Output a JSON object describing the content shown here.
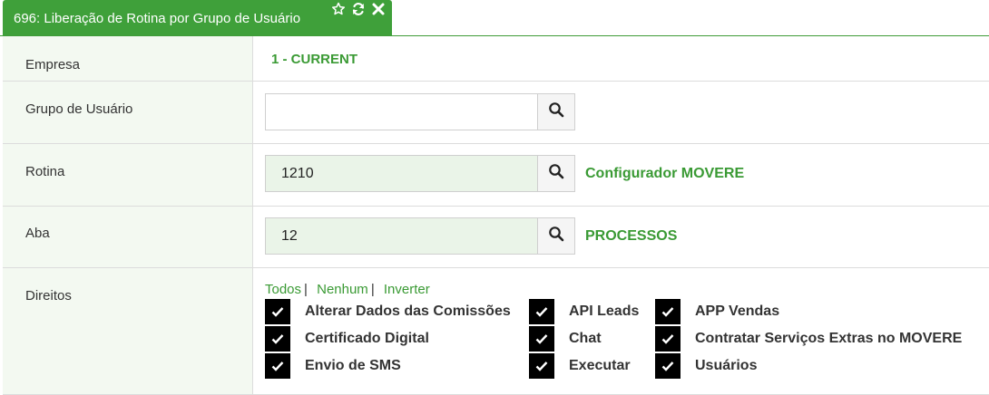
{
  "tab": {
    "title": "696: Liberação de Rotina por Grupo de Usuário"
  },
  "form": {
    "empresa": {
      "label": "Empresa",
      "value": "1 - CURRENT"
    },
    "grupo": {
      "label": "Grupo de Usuário",
      "value": ""
    },
    "rotina": {
      "label": "Rotina",
      "value": "1210",
      "description": "Configurador MOVERE"
    },
    "aba": {
      "label": "Aba",
      "value": "12",
      "description": "PROCESSOS"
    },
    "direitos": {
      "label": "Direitos",
      "links": {
        "todos": "Todos",
        "nenhum": "Nenhum",
        "inverter": "Inverter",
        "sep": "|"
      },
      "checkboxes": [
        {
          "label": "Alterar Dados das Comissões",
          "checked": true
        },
        {
          "label": "API Leads",
          "checked": true
        },
        {
          "label": "APP Vendas",
          "checked": true
        },
        {
          "label": "Certificado Digital",
          "checked": true
        },
        {
          "label": "Chat",
          "checked": true
        },
        {
          "label": "Contratar Serviços Extras no MOVERE",
          "checked": true
        },
        {
          "label": "Envio de SMS",
          "checked": true
        },
        {
          "label": "Executar",
          "checked": true
        },
        {
          "label": "Usuários",
          "checked": true
        }
      ]
    }
  },
  "colors": {
    "accent": "#3fa03a",
    "label_bg": "#f3f9f1",
    "field_filled": "#eaf4e8"
  },
  "icons": [
    "star-icon",
    "refresh-icon",
    "close-icon",
    "search-icon",
    "check-icon"
  ]
}
